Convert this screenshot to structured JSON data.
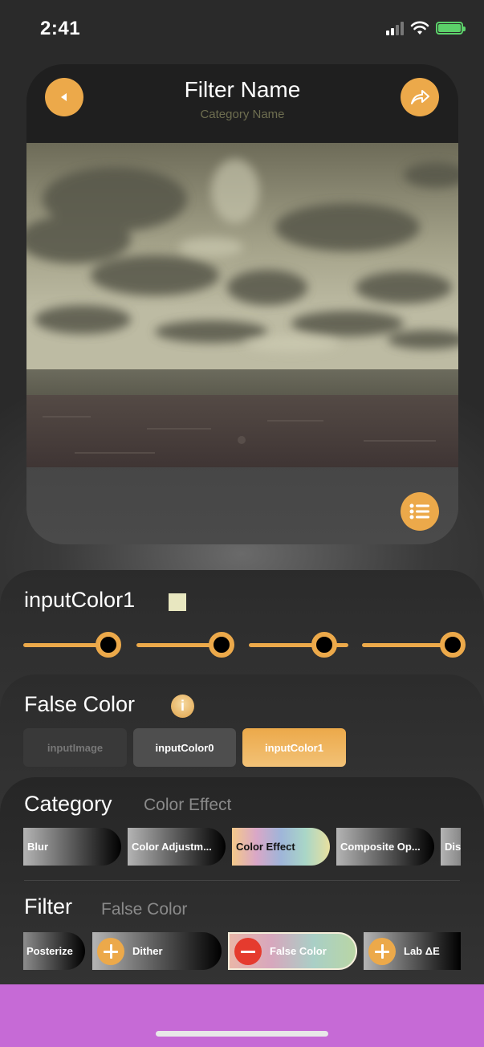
{
  "status": {
    "time": "2:41"
  },
  "header": {
    "title": "Filter Name",
    "subtitle": "Category Name"
  },
  "icons": {
    "back": "back-arrow-icon",
    "share": "share-arrow-icon",
    "list": "list-icon",
    "info": "info-icon"
  },
  "colors": {
    "accent": "#eca94a",
    "selected_color": "#e8e7c0",
    "remove": "#e53b2e",
    "bottom_bar": "#c66ad6"
  },
  "color_control": {
    "label": "inputColor1",
    "channel_values": [
      0.88,
      0.88,
      0.76,
      0.92
    ]
  },
  "filter_panel": {
    "title": "False Color",
    "info_glyph": "i",
    "inputs": [
      "inputImage",
      "inputColor0",
      "inputColor1"
    ],
    "active_input": "inputColor1"
  },
  "category_section": {
    "label": "Category",
    "selected": "Color Effect",
    "chips": [
      "Blur",
      "Color Adjustm...",
      "Color Effect",
      "Composite Op...",
      "Dis"
    ]
  },
  "filter_section": {
    "label": "Filter",
    "selected": "False Color",
    "chips": [
      "Posterize",
      "Dither",
      "False Color",
      "Lab ΔE"
    ]
  }
}
